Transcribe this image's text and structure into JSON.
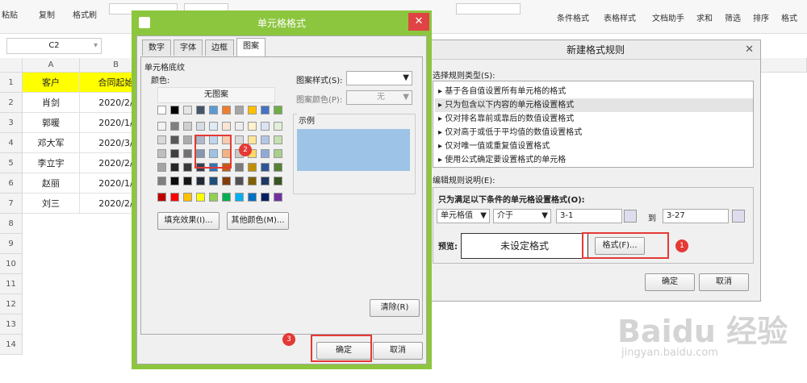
{
  "toolbar": {
    "paste_label": "粘贴",
    "copy_label": "复制",
    "format_brush_label": "格式刷",
    "conditional_format_label": "条件格式",
    "table_style_label": "表格样式",
    "doc_helper_label": "文档助手",
    "sum_label": "求和",
    "filter_label": "筛选",
    "sort_label": "排序",
    "format_label": "格式"
  },
  "namebox": {
    "value": "C2"
  },
  "columns": [
    "A",
    "B"
  ],
  "rows": [
    "1",
    "2",
    "3",
    "4",
    "5",
    "6",
    "7",
    "8",
    "9",
    "10",
    "11",
    "12",
    "13",
    "14"
  ],
  "table": {
    "headers": [
      "客户",
      "合同起始"
    ],
    "data": [
      [
        "肖剑",
        "2020/2/"
      ],
      [
        "郭暖",
        "2020/1/"
      ],
      [
        "邓大军",
        "2020/3/"
      ],
      [
        "李立宇",
        "2020/2/"
      ],
      [
        "赵丽",
        "2020/1/"
      ],
      [
        "刘三",
        "2020/2/"
      ]
    ]
  },
  "cell_format_dialog": {
    "title": "单元格格式",
    "tabs": [
      "数字",
      "字体",
      "边框",
      "图案"
    ],
    "section_label": "单元格底纹",
    "color_label": "颜色:",
    "no_pattern_label": "无图案",
    "fill_effects_button": "填充效果(I)...",
    "more_colors_button": "其他颜色(M)...",
    "pattern_style_label": "图案样式(S):",
    "pattern_color_label": "图案颜色(P):",
    "pattern_color_value": "无",
    "sample_label": "示例",
    "sample_color": "#9dc3e6",
    "clear_button": "清除(R)",
    "ok_button": "确定",
    "cancel_button": "取消",
    "theme_row": [
      "#ffffff",
      "#000000",
      "#e7e6e6",
      "#44546a",
      "#5b9bd5",
      "#ed7d31",
      "#a5a5a5",
      "#ffc000",
      "#4472c4",
      "#70ad47"
    ],
    "shade_rows": [
      [
        "#f2f2f2",
        "#7f7f7f",
        "#d0cece",
        "#d6dce4",
        "#deebf6",
        "#fbe5d5",
        "#ededed",
        "#fff2cc",
        "#dae3f3",
        "#e2efd9"
      ],
      [
        "#d8d8d8",
        "#595959",
        "#aeabab",
        "#adb9ca",
        "#bdd7ee",
        "#f8cbad",
        "#dbdbdb",
        "#ffe598",
        "#b4c6e7",
        "#c5e0b3"
      ],
      [
        "#bfbfbf",
        "#3f3f3f",
        "#757070",
        "#8496b0",
        "#9dc3e6",
        "#f4b183",
        "#c9c9c9",
        "#ffd965",
        "#8eaadb",
        "#a8d08d"
      ],
      [
        "#a5a5a5",
        "#262626",
        "#3a3838",
        "#323f4f",
        "#2e75b5",
        "#c55a11",
        "#7b7b7b",
        "#bf9000",
        "#2f5496",
        "#538135"
      ],
      [
        "#7f7f7f",
        "#0c0c0c",
        "#171616",
        "#222a35",
        "#1f4e79",
        "#833c0b",
        "#525252",
        "#7f6000",
        "#1f3864",
        "#375623"
      ]
    ],
    "standard_row": [
      "#c00000",
      "#ff0000",
      "#ffc000",
      "#ffff00",
      "#92d050",
      "#00b050",
      "#00b0f0",
      "#0070c0",
      "#002060",
      "#7030a0"
    ]
  },
  "new_rule_dialog": {
    "title": "新建格式规则",
    "select_type_label": "选择规则类型(S):",
    "rule_types": [
      "基于各自值设置所有单元格的格式",
      "只为包含以下内容的单元格设置格式",
      "仅对排名靠前或靠后的数值设置格式",
      "仅对高于或低于平均值的数值设置格式",
      "仅对唯一值或重复值设置格式",
      "使用公式确定要设置格式的单元格"
    ],
    "selected_index": 1,
    "edit_desc_label": "编辑规则说明(E):",
    "condition_label": "只为满足以下条件的单元格设置格式(O):",
    "condition_field": "单元格值",
    "condition_op": "介于",
    "value_from": "3-1",
    "to_label": "到",
    "value_to": "3-27",
    "preview_label": "预览:",
    "preview_text": "未设定格式",
    "format_button": "格式(F)...",
    "ok_button": "确定",
    "cancel_button": "取消"
  },
  "badges": [
    "1",
    "2",
    "3"
  ],
  "watermark": {
    "main": "Baidu 经验",
    "sub": "jingyan.baidu.com"
  }
}
